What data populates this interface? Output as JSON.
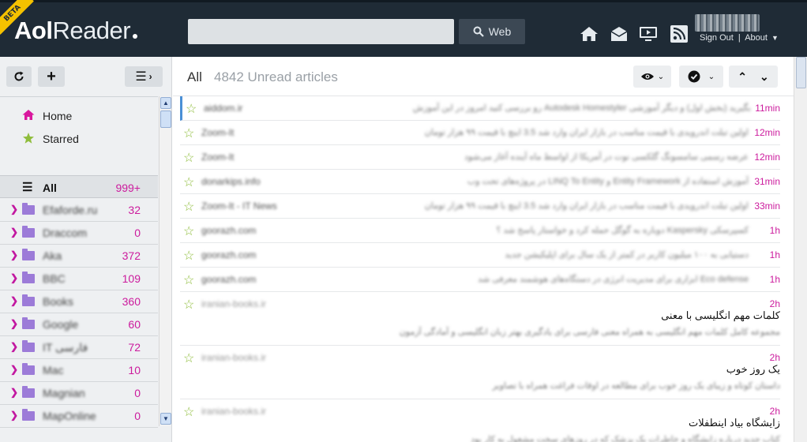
{
  "header": {
    "badge": "BETA",
    "logo_bold": "Aol",
    "logo_light": "Reader",
    "search": {
      "value": "",
      "placeholder": ""
    },
    "web_button": "Web",
    "user": {
      "sign_out": "Sign Out",
      "separator": "|",
      "about": "About"
    }
  },
  "sidebar": {
    "nav": [
      {
        "label": "Home",
        "icon": "home-icon"
      },
      {
        "label": "Starred",
        "icon": "star-icon"
      }
    ],
    "all": {
      "label": "All",
      "count": "999+"
    },
    "folders": [
      {
        "name": "Efaforde.ru",
        "count": "32"
      },
      {
        "name": "Draccom",
        "count": "0"
      },
      {
        "name": "Aka",
        "count": "372"
      },
      {
        "name": "BBC",
        "count": "109"
      },
      {
        "name": "Books",
        "count": "360"
      },
      {
        "name": "Google",
        "count": "60"
      },
      {
        "name": "IT فارسی",
        "count": "72"
      },
      {
        "name": "Mac",
        "count": "10"
      },
      {
        "name": "Magnian",
        "count": "0"
      },
      {
        "name": "MapOnline",
        "count": "0"
      }
    ]
  },
  "main": {
    "view_title": "All",
    "unread": "4842 Unread articles"
  },
  "articles": [
    {
      "source": "aiddom.ir",
      "snippet": "بگیرید (بخش اول) و دیگر آموزشی Autodesk Homestyler رو بررسی کنید امروز در این آموزش",
      "time": "11min"
    },
    {
      "source": "Zoom-It",
      "snippet": "اولین تبلت اندرویدی با قیمت مناسب در بازار ایران وارد شد 3.5 اینچ با قیمت ۹۹ هزار تومان",
      "time": "12min"
    },
    {
      "source": "Zoom-It",
      "snippet": "عرضه رسمی سامسونگ گلکسی نوت در آمریکا از اواسط ماه آینده آغاز می‌شود",
      "time": "12min"
    },
    {
      "source": "donarkips.info",
      "snippet": "آموزش استفاده از Entity Framework و LINQ To Entity در پروژه‌های تحت وب",
      "time": "31min"
    },
    {
      "source": "Zoom-It - IT News",
      "snippet": "اولین تبلت اندرویدی با قیمت مناسب در بازار ایران وارد شد 3.5 اینچ با قیمت ۹۹ هزار تومان",
      "time": "33min"
    },
    {
      "source": "goorazh.com",
      "snippet": "کسپرسکی Kaspersky دوباره به گوگل حمله کرد و خواستار پاسخ شد ؟",
      "time": "1h"
    },
    {
      "source": "goorazh.com",
      "snippet": "دستیابی به ۱۰۰ میلیون کاربر در کمتر از یک سال برای اپلیکیشن جدید",
      "time": "1h"
    },
    {
      "source": "goorazh.com",
      "snippet": "Eco defense ابزاری برای مدیریت انرژی در دستگاه‌های هوشمند معرفی شد",
      "time": "1h"
    },
    {
      "source": "iranian-books.ir",
      "title": "کلمات مهم انگلیسی با معنی",
      "desc": "مجموعه کامل کلمات مهم انگلیسی به همراه معنی فارسی برای یادگیری بهتر زبان انگلیسی و آمادگی آزمون",
      "time": "2h"
    },
    {
      "source": "iranian-books.ir",
      "title": "یک روز خوب",
      "desc": "داستان کوتاه و زیبای یک روز خوب برای مطالعه در اوقات فراغت همراه با تصاویر",
      "time": "2h"
    },
    {
      "source": "iranian-books.ir",
      "title": "زایشگاه بیاد اینطفلات",
      "desc": "کتاب جدید درباره زایشگاه و خاطرات یک پزشک که در روزهای سخت مشغول به کار بود",
      "time": "2h"
    }
  ]
}
